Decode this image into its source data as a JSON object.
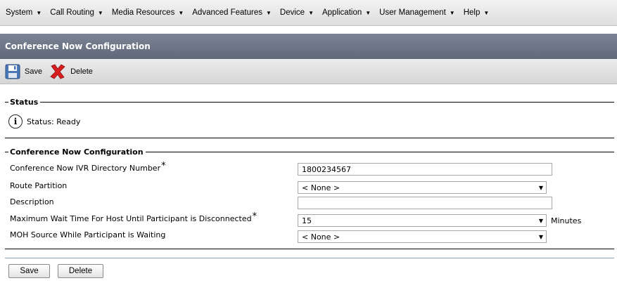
{
  "menu": {
    "items": [
      "System",
      "Call Routing",
      "Media Resources",
      "Advanced Features",
      "Device",
      "Application",
      "User Management",
      "Help"
    ]
  },
  "page": {
    "title": "Conference Now Configuration"
  },
  "toolbar": {
    "save_label": "Save",
    "delete_label": "Delete"
  },
  "status": {
    "section_title": "Status",
    "text": "Status: Ready"
  },
  "config": {
    "section_title": "Conference Now Configuration",
    "ivr_label": "Conference Now IVR Directory Number",
    "ivr_value": "1800234567",
    "partition_label": "Route Partition",
    "partition_value": "< None >",
    "description_label": "Description",
    "description_value": "",
    "wait_label": "Maximum Wait Time For Host Until Participant is Disconnected",
    "wait_value": "15",
    "wait_units": "Minutes",
    "moh_label": "MOH Source While Participant is Waiting",
    "moh_value": "< None >",
    "required_marker": "*"
  },
  "buttons": {
    "save": "Save",
    "delete": "Delete"
  }
}
